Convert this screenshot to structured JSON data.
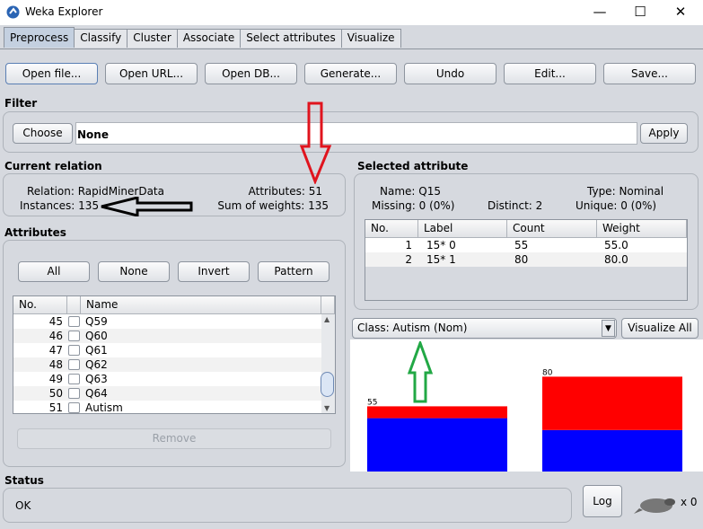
{
  "window": {
    "title": "Weka Explorer",
    "minimize": "—",
    "maximize": "☐",
    "close": "✕"
  },
  "tabs": [
    "Preprocess",
    "Classify",
    "Cluster",
    "Associate",
    "Select attributes",
    "Visualize"
  ],
  "toolbar": [
    "Open file...",
    "Open URL...",
    "Open DB...",
    "Generate...",
    "Undo",
    "Edit...",
    "Save..."
  ],
  "filter": {
    "title": "Filter",
    "choose": "Choose",
    "value": "None",
    "apply": "Apply"
  },
  "relation": {
    "title": "Current relation",
    "relation_label": "Relation:",
    "relation": "RapidMinerData",
    "instances_label": "Instances:",
    "instances": "135",
    "attributes_label": "Attributes:",
    "attributes": "51",
    "weights_label": "Sum of weights:",
    "weights": "135"
  },
  "attributes": {
    "title": "Attributes",
    "buttons": [
      "All",
      "None",
      "Invert",
      "Pattern"
    ],
    "columns": [
      "No.",
      "Name"
    ],
    "rows": [
      {
        "no": "45",
        "name": "Q59"
      },
      {
        "no": "46",
        "name": "Q60"
      },
      {
        "no": "47",
        "name": "Q61"
      },
      {
        "no": "48",
        "name": "Q62"
      },
      {
        "no": "49",
        "name": "Q63"
      },
      {
        "no": "50",
        "name": "Q64"
      },
      {
        "no": "51",
        "name": "Autism"
      }
    ],
    "remove": "Remove"
  },
  "selected": {
    "title": "Selected attribute",
    "name_label": "Name:",
    "name": "Q15",
    "type_label": "Type:",
    "type": "Nominal",
    "missing_label": "Missing:",
    "missing": "0 (0%)",
    "distinct_label": "Distinct:",
    "distinct": "2",
    "unique_label": "Unique:",
    "unique": "0 (0%)",
    "columns": [
      "No.",
      "Label",
      "Count",
      "Weight"
    ],
    "rows": [
      {
        "no": "1",
        "label": "15* 0",
        "count": "55",
        "weight": "55.0"
      },
      {
        "no": "2",
        "label": "15* 1",
        "count": "80",
        "weight": "80.0"
      }
    ]
  },
  "class_select": "Class: Autism (Nom)",
  "visualize_all": "Visualize All",
  "chart_data": {
    "type": "bar",
    "stacked": true,
    "categories": [
      "15* 0",
      "15* 1"
    ],
    "totals": [
      55,
      80
    ],
    "data_labels": [
      "55",
      "80"
    ],
    "series": [
      {
        "color": "#0000ff",
        "values": [
          45,
          35
        ]
      },
      {
        "color": "#ff0000",
        "values": [
          10,
          45
        ]
      }
    ]
  },
  "status": {
    "title": "Status",
    "text": "OK",
    "log": "Log",
    "count": "x 0"
  },
  "annotations": {
    "red_arrow": "#e0141e",
    "black_arrow": "#000000",
    "green_arrow": "#22a845"
  }
}
